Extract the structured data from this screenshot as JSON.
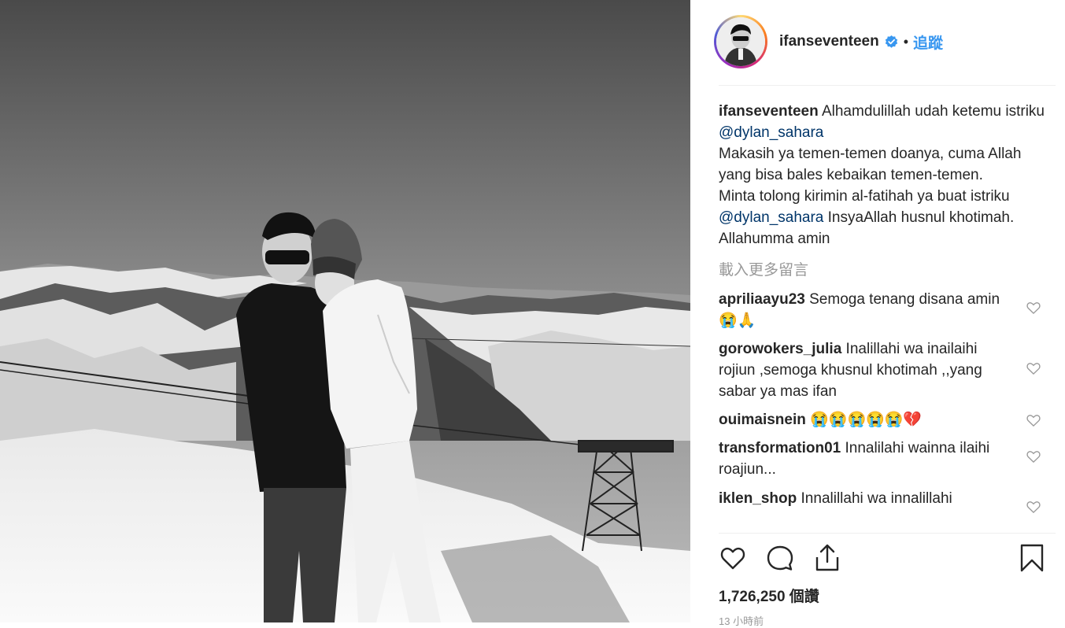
{
  "post": {
    "username": "ifanseventeen",
    "separator": "•",
    "follow_label": "追蹤",
    "caption": {
      "username": "ifanseventeen",
      "part1": " Alhamdulillah udah ketemu istriku ",
      "mention1": "@dylan_sahara",
      "part2": "Makasih ya temen-temen doanya, cuma Allah yang bisa bales kebaikan temen-temen.",
      "part3": "Minta tolong kirimin al-fatihah ya buat istriku ",
      "mention2": "@dylan_sahara",
      "part4": " InsyaAllah husnul khotimah. Allahumma amin"
    },
    "load_more_label": "載入更多留言",
    "comments": [
      {
        "username": "apriliaayu23",
        "text": " Semoga tenang disana amin 😭🙏"
      },
      {
        "username": "gorowokers_julia",
        "text": " Inalillahi wa inailaihi rojiun ,semoga khusnul khotimah ,,yang sabar ya mas ifan"
      },
      {
        "username": "ouimaisnein",
        "text": " 😭😭😭😭😭💔"
      },
      {
        "username": "transformation01",
        "text": " Innalilahi wainna ilaihi roajiun..."
      },
      {
        "username": "iklen_shop",
        "text": " Innalillahi wa innalillahi"
      }
    ],
    "likes": "1,726,250 個讚",
    "timestamp": "13 小時前"
  },
  "icons": {
    "verified": "verified-badge-icon",
    "like": "heart-icon",
    "comment": "comment-bubble-icon",
    "share": "share-icon",
    "save": "bookmark-icon"
  },
  "colors": {
    "link": "#3897f0",
    "mention": "#003569",
    "muted": "#999999",
    "verified": "#3897f0"
  }
}
